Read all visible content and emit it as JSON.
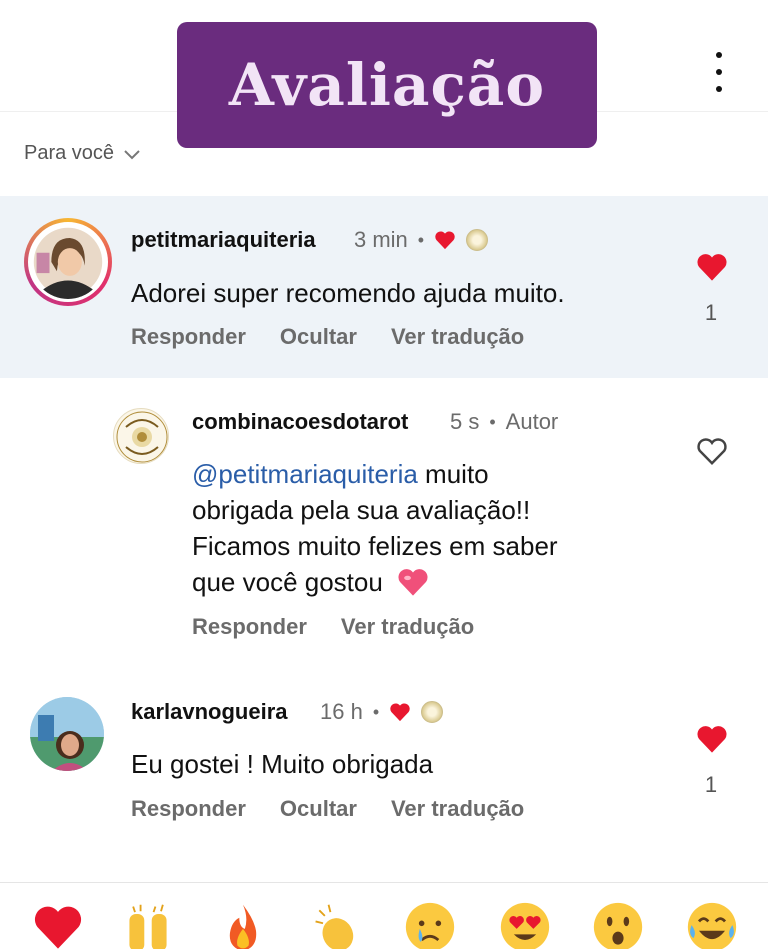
{
  "banner": {
    "title": "Avaliação"
  },
  "sort": {
    "label": "Para você"
  },
  "comments": [
    {
      "username": "petitmariaquiteria",
      "time": "3 min",
      "text": "Adorei super recomendo ajuda muito.",
      "actions": [
        "Responder",
        "Ocultar",
        "Ver tradução"
      ],
      "likes": "1"
    },
    {
      "username": "combinacoesdotarot",
      "time": "5 s",
      "role": "Autor",
      "mention": "@petitmariaquiteria",
      "text_lines": [
        " muito",
        "obrigada pela sua avaliação!!",
        "Ficamos muito felizes em saber",
        "que você gostou"
      ],
      "actions": [
        "Responder",
        "Ver tradução"
      ]
    },
    {
      "username": "karlavnogueira",
      "time": "16 h",
      "text": "Eu gostei ! Muito obrigada",
      "actions": [
        "Responder",
        "Ocultar",
        "Ver tradução"
      ],
      "likes": "1"
    }
  ],
  "emoji_bar": [
    "heart",
    "raising-hands",
    "fire",
    "clapping-hands",
    "crying-face",
    "heart-eyes",
    "surprised-face",
    "tears-of-joy"
  ],
  "colors": {
    "banner": "#6a2c7e",
    "like_red": "#e8172f",
    "mention_blue": "#2a5da8",
    "highlight": "#eef3f8"
  }
}
